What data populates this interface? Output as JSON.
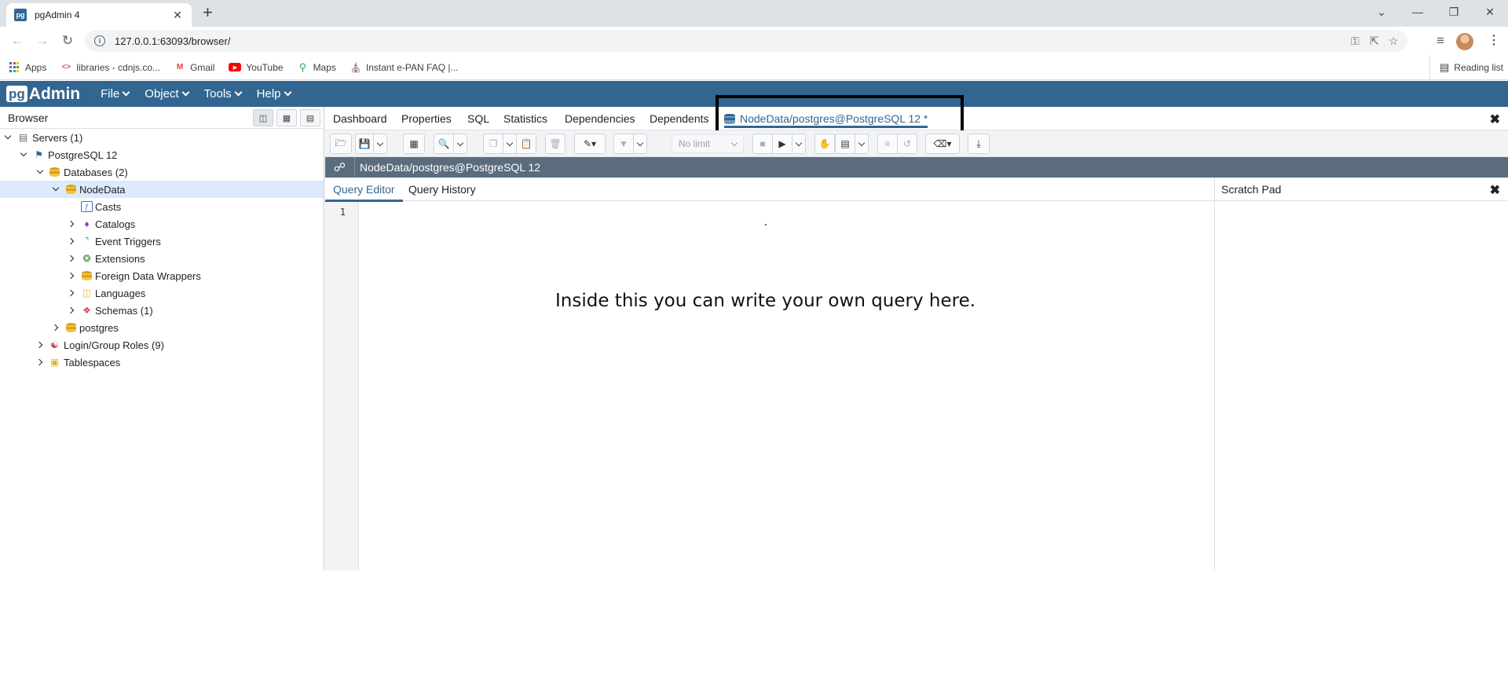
{
  "browser_tab": {
    "favicon": "pg",
    "title": "pgAdmin 4",
    "close": "✕",
    "new_tab": "+"
  },
  "window_controls": {
    "minimize": "—",
    "restore": "❐",
    "close": "✕",
    "tab_search": "⌄"
  },
  "address_bar": {
    "url": "127.0.0.1:63093/browser/"
  },
  "bookmarks": [
    {
      "label": "Apps",
      "icon": "apps-grid-icon"
    },
    {
      "label": "libraries - cdnjs.co...",
      "icon": "code-brackets-icon"
    },
    {
      "label": "Gmail",
      "icon": "gmail-icon"
    },
    {
      "label": "YouTube",
      "icon": "youtube-icon"
    },
    {
      "label": "Maps",
      "icon": "maps-pin-icon"
    },
    {
      "label": "Instant e-PAN FAQ |...",
      "icon": "building-icon"
    }
  ],
  "reading_list": "Reading list",
  "pgadmin": {
    "logo_box": "pg",
    "logo_text": "Admin",
    "menus": [
      "File",
      "Object",
      "Tools",
      "Help"
    ]
  },
  "browser_panel": {
    "title": "Browser",
    "tree": [
      {
        "label": "Servers (1)",
        "icon": "servers-icon"
      },
      {
        "label": "PostgreSQL 12",
        "icon": "postgres-elephant-icon"
      },
      {
        "label": "Databases (2)",
        "icon": "databases-icon"
      },
      {
        "label": "NodeData",
        "icon": "database-icon"
      },
      {
        "label": "Casts",
        "icon": "casts-icon"
      },
      {
        "label": "Catalogs",
        "icon": "catalogs-icon"
      },
      {
        "label": "Event Triggers",
        "icon": "event-triggers-icon"
      },
      {
        "label": "Extensions",
        "icon": "extensions-icon"
      },
      {
        "label": "Foreign Data Wrappers",
        "icon": "foreign-data-wrappers-icon"
      },
      {
        "label": "Languages",
        "icon": "languages-icon"
      },
      {
        "label": "Schemas (1)",
        "icon": "schemas-icon"
      },
      {
        "label": "postgres",
        "icon": "database-icon"
      },
      {
        "label": "Login/Group Roles (9)",
        "icon": "roles-icon"
      },
      {
        "label": "Tablespaces",
        "icon": "tablespaces-icon"
      }
    ]
  },
  "main_tabs": [
    "Dashboard",
    "Properties",
    "SQL",
    "Statistics",
    "Dependencies",
    "Dependents",
    "NodeData/postgres@PostgreSQL 12 *"
  ],
  "toolbar": {
    "limit_select": "No limit"
  },
  "connection": {
    "label": "NodeData/postgres@PostgreSQL 12"
  },
  "editor": {
    "tabs": [
      "Query Editor",
      "Query History"
    ],
    "line_numbers": [
      "1"
    ],
    "annotation": "Inside this you can write your own query here."
  },
  "scratch_pad": {
    "title": "Scratch Pad"
  },
  "colors": {
    "pgadmin_blue": "#326690",
    "connection_bar": "#5b6d7d",
    "selected_row": "#dbeafc"
  }
}
